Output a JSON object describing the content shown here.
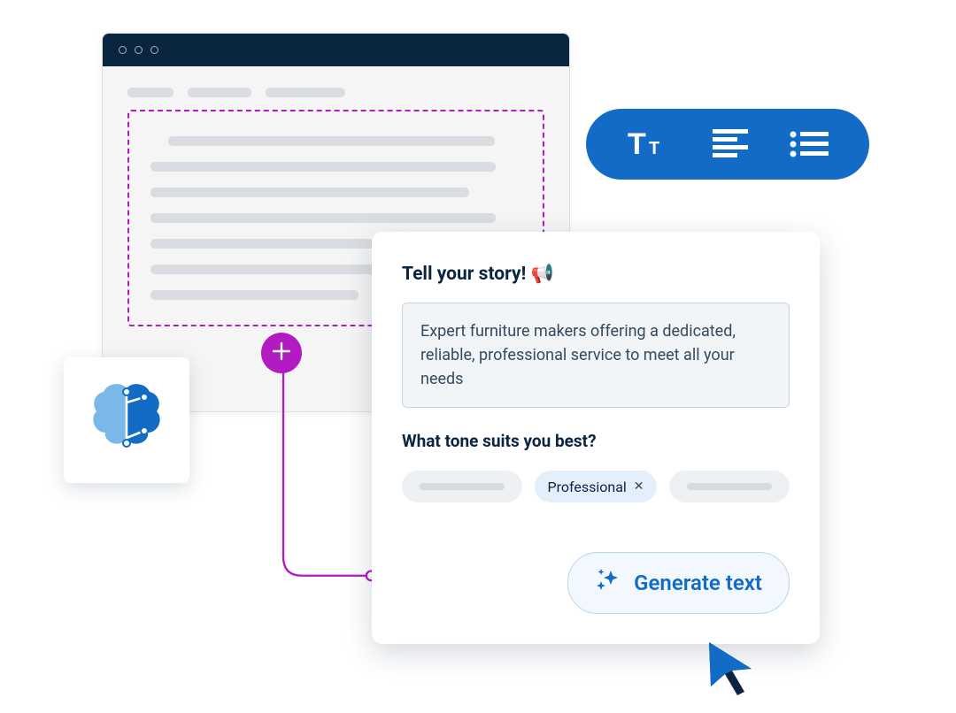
{
  "colors": {
    "brand_blue": "#126bc5",
    "navy": "#0a2540",
    "magenta": "#b21bc1",
    "light_blue": "#e3f0fb"
  },
  "panel": {
    "title": "Tell your story! 📢",
    "story_text": "Expert furniture makers offering a dedicated, reliable, professional service to meet all your needs",
    "tone_question": "What tone suits you best?",
    "selected_tone": "Professional",
    "generate_label": "Generate text"
  },
  "toolbar": {
    "icons": [
      "text-size-icon",
      "align-icon",
      "list-icon"
    ]
  },
  "brain_icon": "ai-brain-icon",
  "add_icon": "plus-icon",
  "cursor_icon": "cursor-arrow"
}
